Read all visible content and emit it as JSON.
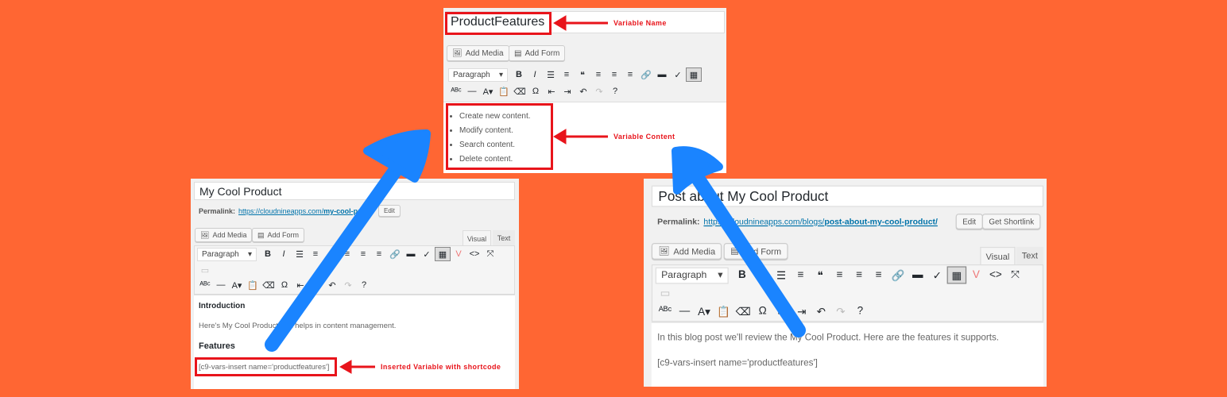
{
  "colors": {
    "background": "#ff6633",
    "arrow_blue": "#1a84ff",
    "annotation_red": "#e8141b"
  },
  "panel_variable": {
    "title": "ProductFeatures",
    "add_media": "Add Media",
    "add_form": "Add Form",
    "format_select": "Paragraph",
    "list_items": [
      "Create new content.",
      "Modify content.",
      "Search content.",
      "Delete content."
    ],
    "annotation_name": "Variable Name",
    "annotation_content": "Variable Content"
  },
  "panel_product": {
    "title": "My Cool Product",
    "permalink_label": "Permalink:",
    "permalink_base": "https://cloudnineapps.com/",
    "permalink_slug": "my-cool-pro",
    "edit": "Edit",
    "add_media": "Add Media",
    "add_form": "Add Form",
    "tab_visual": "Visual",
    "tab_text": "Text",
    "format_select": "Paragraph",
    "heading_intro": "Introduction",
    "intro_text": "Here's My Cool Product that helps in content management.",
    "heading_features": "Features",
    "shortcode": "[c9-vars-insert name='productfeatures']",
    "annotation": "Inserted Variable with shortcode"
  },
  "panel_post": {
    "title": "Post about My Cool Product",
    "permalink_label": "Permalink:",
    "permalink_base": "https://cloudnineapps.com/blogs/",
    "permalink_slug": "post-about-my-cool-product/",
    "edit": "Edit",
    "get_shortlink": "Get Shortlink",
    "add_media": "Add Media",
    "add_form": "Add Form",
    "tab_visual": "Visual",
    "tab_text": "Text",
    "format_select": "Paragraph",
    "intro_text": "In this blog post we'll review the My Cool Product. Here are the features it supports.",
    "shortcode": "[c9-vars-insert name='productfeatures']"
  },
  "toolbar_row1": [
    "bold",
    "italic",
    "bullet-list",
    "numbered-list",
    "blockquote",
    "align-left",
    "align-center",
    "align-right",
    "link",
    "read-more",
    "spellcheck",
    "toolbar-toggle",
    "variables-plugin",
    "code",
    "fullscreen"
  ],
  "toolbar_row2": [
    "strikethrough",
    "horizontal-line",
    "text-color",
    "paste-text",
    "clear-formatting",
    "special-character",
    "outdent",
    "indent",
    "undo",
    "redo",
    "help"
  ]
}
